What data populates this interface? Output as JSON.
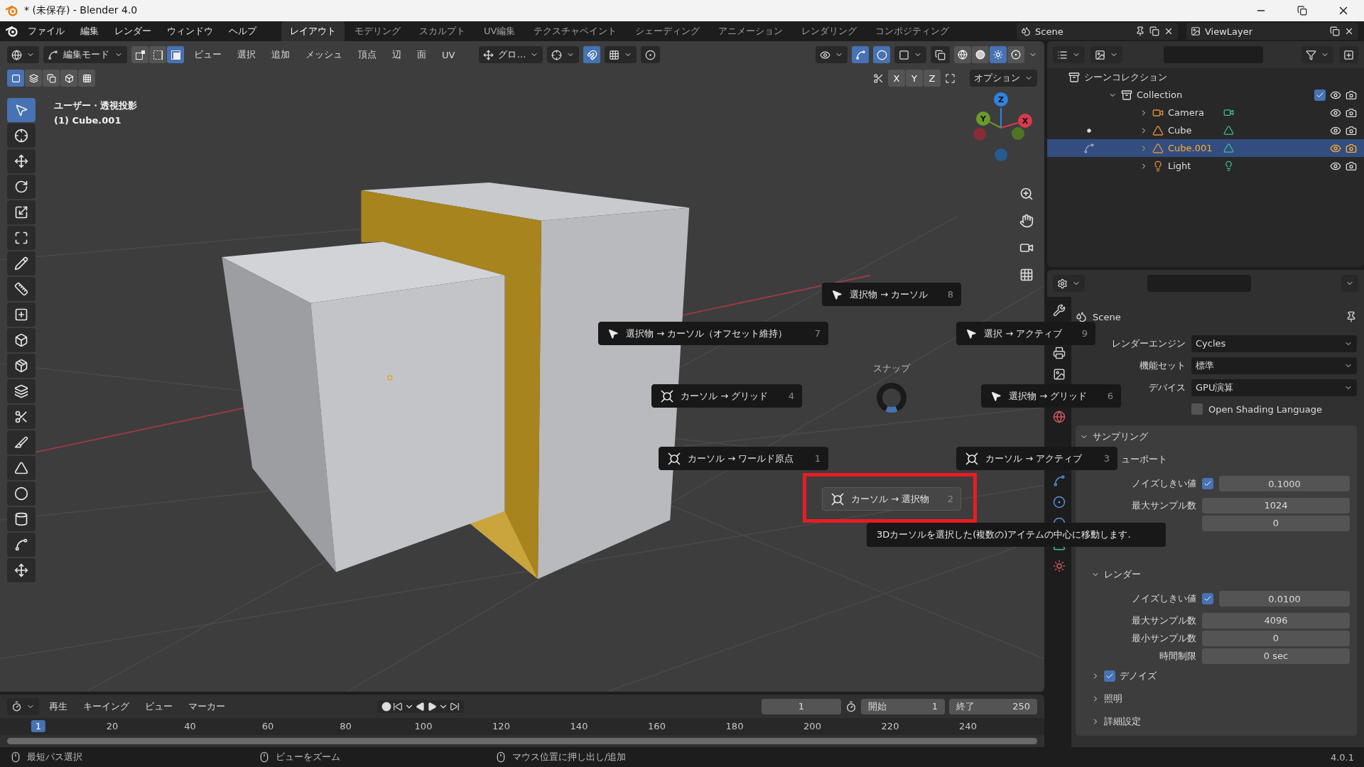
{
  "window": {
    "title": "* (未保存) - Blender 4.0"
  },
  "menu_bar": {
    "menus": [
      "ファイル",
      "編集",
      "レンダー",
      "ウィンドウ",
      "ヘルプ"
    ],
    "workspaces": [
      {
        "label": "レイアウト",
        "selected": true
      },
      {
        "label": "モデリング",
        "selected": false
      },
      {
        "label": "スカルプト",
        "selected": false
      },
      {
        "label": "UV編集",
        "selected": false
      },
      {
        "label": "テクスチャペイント",
        "selected": false
      },
      {
        "label": "シェーディング",
        "selected": false
      },
      {
        "label": "アニメーション",
        "selected": false
      },
      {
        "label": "レンダリング",
        "selected": false
      },
      {
        "label": "コンポジティング",
        "selected": false
      }
    ],
    "scene": "Scene",
    "view_layer": "ViewLayer"
  },
  "viewport": {
    "mode": "編集モード",
    "select_modes": [
      {
        "selected": false
      },
      {
        "selected": false
      },
      {
        "selected": true
      }
    ],
    "menus": [
      "ビュー",
      "選択",
      "追加",
      "メッシュ",
      "頂点",
      "辺",
      "面",
      "UV"
    ],
    "orientation": "グロ…",
    "axes": [
      "X",
      "Y",
      "Z"
    ],
    "options": "オプション",
    "select_tools": [
      {
        "selected": true
      },
      {
        "selected": false
      },
      {
        "selected": false
      },
      {
        "selected": false
      },
      {
        "selected": false
      }
    ],
    "view_name": "ユーザー・透視投影",
    "object_name": "(1) Cube.001",
    "gizmo_axes": [
      "Z",
      "Y",
      "X"
    ],
    "tools": [
      {
        "selected": true
      },
      {
        "selected": false
      },
      {
        "selected": false
      },
      {
        "selected": false
      },
      {
        "selected": false
      },
      {
        "selected": false
      },
      {
        "selected": false
      },
      {
        "selected": false
      },
      {
        "selected": false
      },
      {
        "selected": false
      },
      {
        "selected": false
      },
      {
        "selected": false
      },
      {
        "selected": false
      },
      {
        "selected": false
      },
      {
        "selected": false
      },
      {
        "selected": false
      },
      {
        "selected": false
      },
      {
        "selected": false
      },
      {
        "selected": false
      }
    ]
  },
  "pie": {
    "title": "スナップ",
    "items": [
      {
        "label": "選択物 → カーソル",
        "key": "8",
        "kind": "arrow",
        "selected": false
      },
      {
        "label": "選択物 → カーソル（オフセット維持）",
        "key": "7",
        "kind": "arrow",
        "selected": false
      },
      {
        "label": "選択 → アクティブ",
        "key": "9",
        "kind": "arrow",
        "selected": false
      },
      {
        "label": "カーソル → グリッド",
        "key": "4",
        "kind": "cursor",
        "selected": false
      },
      {
        "label": "選択物 → グリッド",
        "key": "6",
        "kind": "arrow",
        "selected": false
      },
      {
        "label": "カーソル → ワールド原点",
        "key": "1",
        "kind": "cursor",
        "selected": false
      },
      {
        "label": "カーソル → アクティブ",
        "key": "3",
        "kind": "cursor",
        "selected": false
      },
      {
        "label": "カーソル → 選択物",
        "key": "2",
        "kind": "cursor",
        "selected": true
      }
    ],
    "tooltip": "3Dカーソルを選択した(複数の)アイテムの中心に移動します."
  },
  "outliner": {
    "root": "シーンコレクション",
    "tree": [
      {
        "label": "Collection",
        "kind": "collection",
        "expanded": true,
        "checked": true,
        "selected": false,
        "children": [
          {
            "label": "Camera",
            "kind": "camera",
            "expanded": false,
            "selected": false,
            "active": false,
            "editing": false
          },
          {
            "label": "Cube",
            "kind": "mesh",
            "expanded": false,
            "selected": false,
            "active": true,
            "editing": false
          },
          {
            "label": "Cube.001",
            "kind": "mesh",
            "expanded": false,
            "selected": true,
            "active": false,
            "editing": true
          },
          {
            "label": "Light",
            "kind": "light",
            "expanded": false,
            "selected": false,
            "active": false,
            "editing": false
          }
        ]
      }
    ]
  },
  "properties": {
    "context": "Scene",
    "fields": [
      {
        "label": "レンダーエンジン",
        "value": "Cycles"
      },
      {
        "label": "機能セット",
        "value": "標準"
      },
      {
        "label": "デバイス",
        "value": "GPU演算"
      }
    ],
    "osl": {
      "label": "Open Shading Language",
      "checked": false
    },
    "sampling": {
      "title": "サンプリング",
      "expanded": true,
      "viewport": {
        "title": "ューポート",
        "noise": {
          "label": "ノイズしきい値",
          "checked": true,
          "value": "0.1000"
        },
        "rows": [
          {
            "label": "最大サンプル数",
            "value": "1024"
          },
          {
            "value": "0"
          }
        ]
      },
      "render": {
        "title": "レンダー",
        "expanded": true,
        "noise": {
          "label": "ノイズしきい値",
          "checked": true,
          "value": "0.0100"
        },
        "rows": [
          {
            "label": "最大サンプル数",
            "value": "4096"
          },
          {
            "label": "最小サンプル数",
            "value": "0"
          },
          {
            "label": "時間制限",
            "value": "0 sec"
          }
        ]
      },
      "subpanels": [
        {
          "label": "デノイズ",
          "kind": "check",
          "checked": true,
          "expanded": false
        },
        {
          "label": "照明",
          "kind": "plain",
          "expanded": false
        },
        {
          "label": "詳細設定",
          "kind": "plain",
          "expanded": false
        }
      ]
    }
  },
  "timeline": {
    "menus": [
      "再生",
      "キーイング",
      "ビュー",
      "マーカー"
    ],
    "frame": "1",
    "start_label": "開始",
    "start": "1",
    "end_label": "終了",
    "end": "250",
    "current": "1",
    "ticks": [
      "20",
      "40",
      "60",
      "80",
      "100",
      "120",
      "140",
      "160",
      "180",
      "200",
      "220",
      "240"
    ]
  },
  "status_bar": {
    "hints": [
      "最短パス選択",
      "ビューをズーム",
      "マウス位置に押し出し/追加"
    ],
    "version": "4.0.1"
  }
}
